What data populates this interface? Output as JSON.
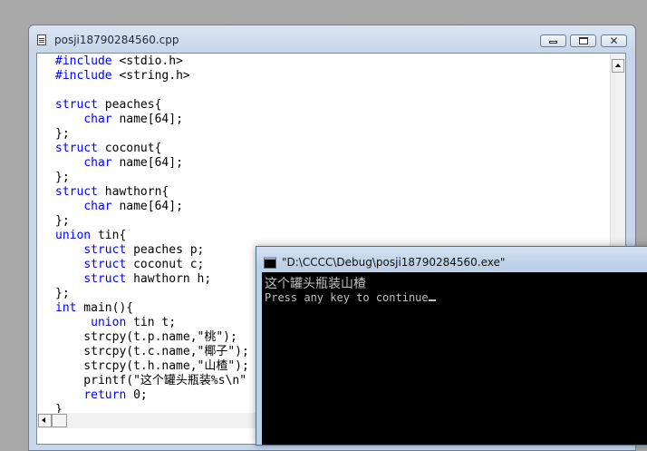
{
  "editor": {
    "title": "posji18790284560.cpp",
    "code_lines": [
      "#include <stdio.h>",
      "#include <string.h>",
      "",
      "struct peaches{",
      "    char name[64];",
      "};",
      "struct coconut{",
      "    char name[64];",
      "};",
      "struct hawthorn{",
      "    char name[64];",
      "};",
      "union tin{",
      "    struct peaches p;",
      "    struct coconut c;",
      "    struct hawthorn h;",
      "};",
      "int main(){",
      "     union tin t;",
      "    strcpy(t.p.name,\"桃\");",
      "    strcpy(t.c.name,\"椰子\");",
      "    strcpy(t.h.name,\"山楂\");",
      "    printf(\"这个罐头瓶装%s\\n\"",
      "    return 0;",
      "}"
    ],
    "keywords": [
      "#include",
      "struct",
      "char",
      "union",
      "int",
      "return"
    ],
    "keyword_color": "#0000ff"
  },
  "console": {
    "title": "\"D:\\CCCC\\Debug\\posji18790284560.exe\"",
    "output_line": "这个罐头瓶装山楂",
    "prompt_line": "Press any key to continue"
  }
}
